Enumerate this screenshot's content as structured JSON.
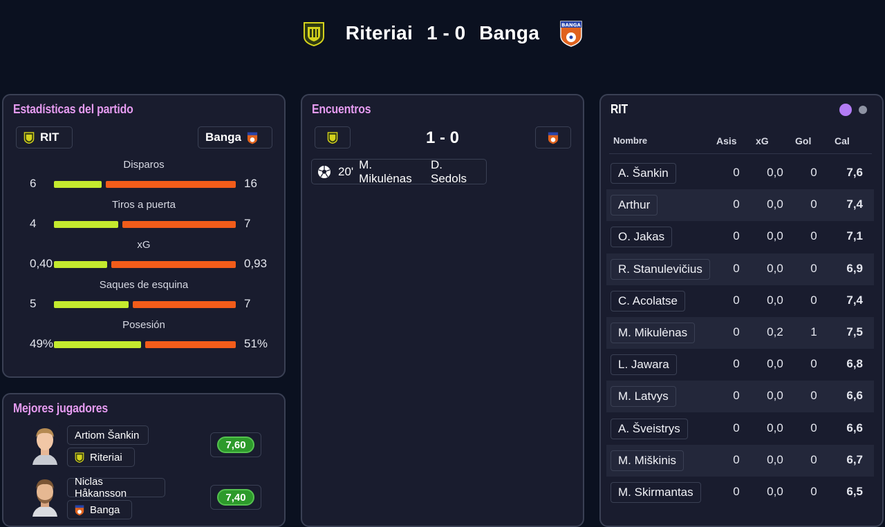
{
  "match": {
    "home_team": "Riteriai",
    "score": "1 - 0",
    "away_team": "Banga"
  },
  "stats": {
    "title": "Estadísticas del partido",
    "home_tag": "RIT",
    "away_tag": "Banga",
    "rows": [
      {
        "label": "Disparos",
        "home": "6",
        "away": "16",
        "home_share": 0.27
      },
      {
        "label": "Tiros a puerta",
        "home": "4",
        "away": "7",
        "home_share": 0.36
      },
      {
        "label": "xG",
        "home": "0,40",
        "away": "0,93",
        "home_share": 0.3
      },
      {
        "label": "Saques de esquina",
        "home": "5",
        "away": "7",
        "home_share": 0.42
      },
      {
        "label": "Posesión",
        "home": "49%",
        "away": "51%",
        "home_share": 0.49
      }
    ],
    "colors": {
      "home_bar": "#c4ea2e",
      "away_bar": "#f25c1a"
    }
  },
  "best_players": {
    "title": "Mejores jugadores",
    "players": [
      {
        "name": "Artiom Šankin",
        "team": "Riteriai",
        "rating": "7,60"
      },
      {
        "name": "Niclas Håkansson",
        "team": "Banga",
        "rating": "7,40"
      }
    ]
  },
  "encounters": {
    "title": "Encuentros",
    "score": "1 - 0",
    "events": [
      {
        "icon": "football-icon",
        "minute": "20'",
        "scorer": "M. Mikulėnas",
        "assist": "D. Sedols"
      }
    ]
  },
  "lineup": {
    "team": "RIT",
    "headers": {
      "name": "Nombre",
      "assists": "Asis",
      "xg": "xG",
      "goals": "Gol",
      "rating": "Cal"
    },
    "players": [
      {
        "name": "A. Šankin",
        "asis": "0",
        "xg": "0,0",
        "gol": "0",
        "cal": "7,6"
      },
      {
        "name": "Arthur",
        "asis": "0",
        "xg": "0,0",
        "gol": "0",
        "cal": "7,4"
      },
      {
        "name": "O. Jakas",
        "asis": "0",
        "xg": "0,0",
        "gol": "0",
        "cal": "7,1"
      },
      {
        "name": "R. Stanulevičius",
        "asis": "0",
        "xg": "0,0",
        "gol": "0",
        "cal": "6,9"
      },
      {
        "name": "C. Acolatse",
        "asis": "0",
        "xg": "0,0",
        "gol": "0",
        "cal": "7,4"
      },
      {
        "name": "M. Mikulėnas",
        "asis": "0",
        "xg": "0,2",
        "gol": "1",
        "cal": "7,5"
      },
      {
        "name": "L. Jawara",
        "asis": "0",
        "xg": "0,0",
        "gol": "0",
        "cal": "6,8"
      },
      {
        "name": "M. Latvys",
        "asis": "0",
        "xg": "0,0",
        "gol": "0",
        "cal": "6,6"
      },
      {
        "name": "A. Šveistrys",
        "asis": "0",
        "xg": "0,0",
        "gol": "0",
        "cal": "6,6"
      },
      {
        "name": "M. Miškinis",
        "asis": "0",
        "xg": "0,0",
        "gol": "0",
        "cal": "6,7"
      },
      {
        "name": "M. Skirmantas",
        "asis": "0",
        "xg": "0,0",
        "gol": "0",
        "cal": "6,5"
      }
    ],
    "pager": {
      "active_color": "#b37cf5",
      "inactive_color": "#8e93a3"
    }
  }
}
